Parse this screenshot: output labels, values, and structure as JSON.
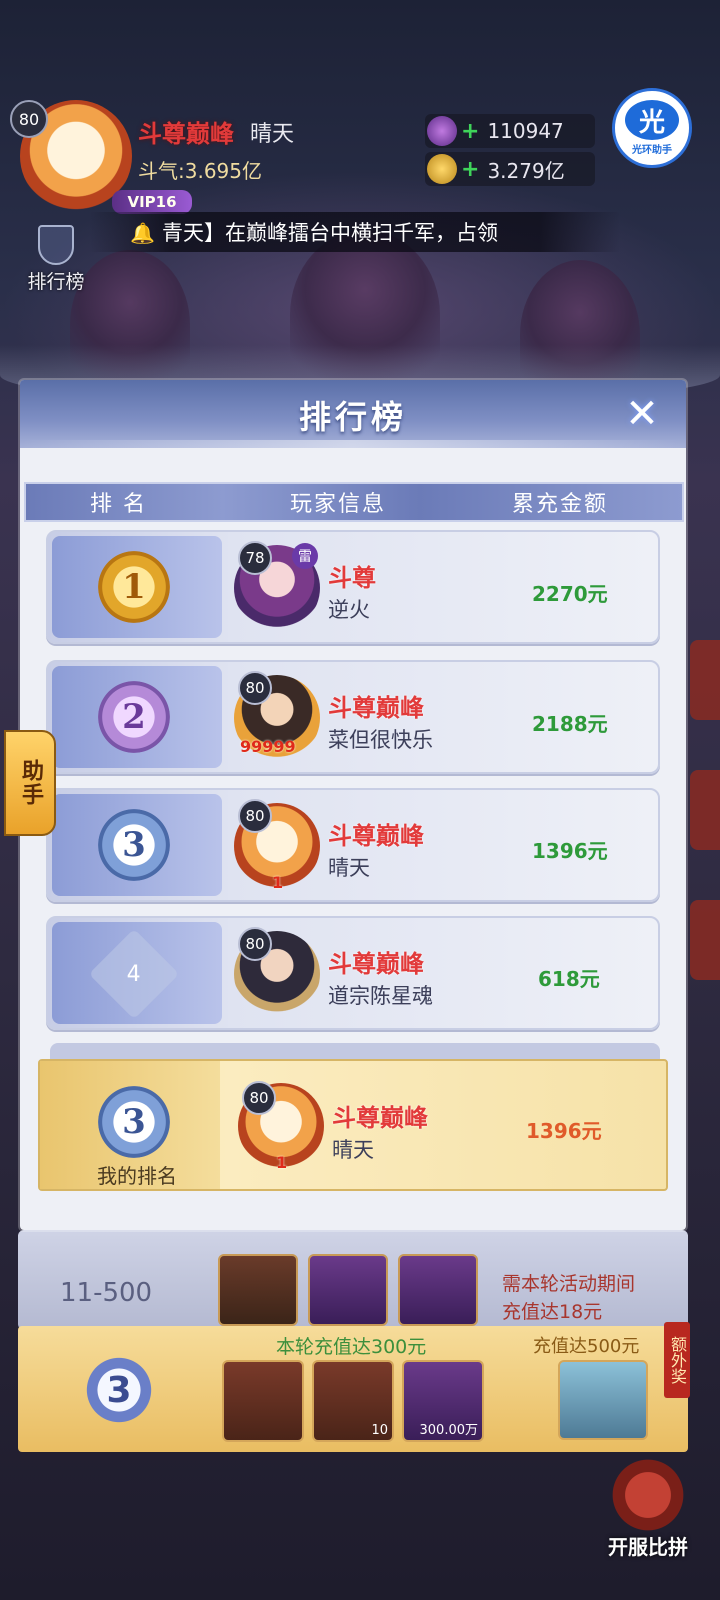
{
  "header": {
    "level": "80",
    "title": "斗尊巅峰",
    "name": "晴天",
    "power": "斗气:3.695亿",
    "vip": "VIP16",
    "resource_1": "110947",
    "resource_2": "3.279亿",
    "assist_badge_big": "光",
    "assist_badge_small": "光环助手"
  },
  "marquee": {
    "text": "青天】在巅峰擂台中横扫千军，占领"
  },
  "rank_entry_label": "排行榜",
  "side_helper_label": "助手",
  "modal": {
    "title": "排行榜",
    "close": "✕",
    "columns": [
      "排 名",
      "玩家信息",
      "累充金额"
    ],
    "rows": [
      {
        "rank": "1",
        "level": "78",
        "title": "斗尊",
        "name": "逆火",
        "amount": "2270元",
        "tag": "雷"
      },
      {
        "rank": "2",
        "level": "80",
        "title": "斗尊巅峰",
        "name": "菜但很快乐",
        "amount": "2188元",
        "tag": "99999"
      },
      {
        "rank": "3",
        "level": "80",
        "title": "斗尊巅峰",
        "name": "晴天",
        "amount": "1396元",
        "tag": "1"
      },
      {
        "rank": "4",
        "level": "80",
        "title": "斗尊巅峰",
        "name": "道宗陈星魂",
        "amount": "618元",
        "tag": ""
      }
    ],
    "mine": {
      "rank": "3",
      "label": "我的排名",
      "level": "80",
      "title": "斗尊巅峰",
      "name": "晴天",
      "amount": "1396元",
      "tag": "1"
    }
  },
  "bottom": {
    "range": "11-500",
    "note_line1": "需本轮活动期间",
    "note_line2": "充值达18元",
    "sub1": "本轮充值达300元",
    "sub2": "充值达500元",
    "extra": "额外奖",
    "item_count_1": "10",
    "item_count_2": "300.00万",
    "rank": "3",
    "open_server": "开服比拼"
  }
}
